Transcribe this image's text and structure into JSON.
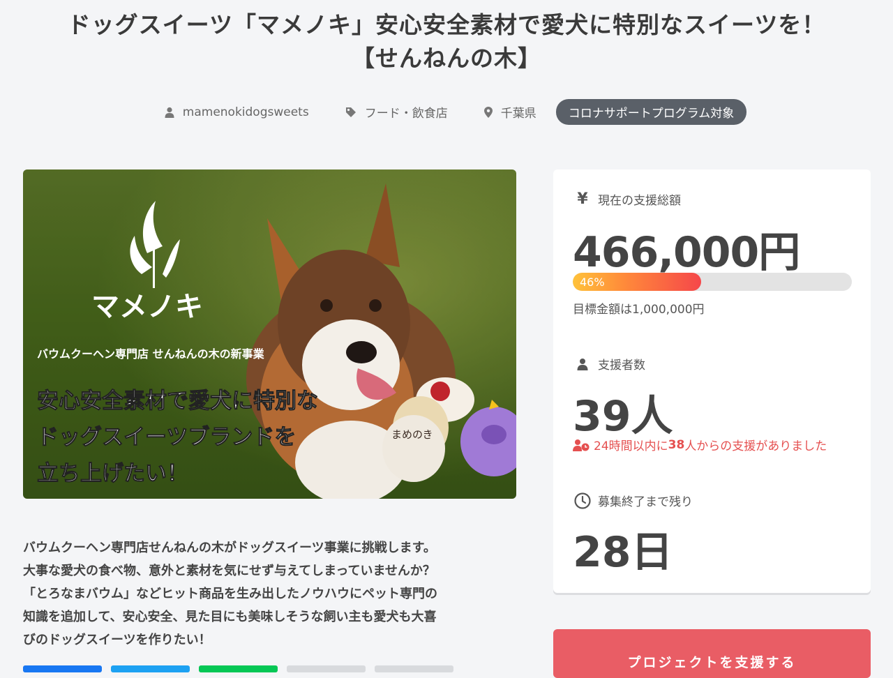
{
  "title": {
    "line1": "ドッグスイーツ「マメノキ」安心安全素材で愛犬に特別なスイーツを！",
    "line2": "【せんねんの木】"
  },
  "meta": {
    "owner": "mamenokidogsweets",
    "category": "フード・飲食店",
    "location": "千葉県",
    "badge": "コロナサポートプログラム対象"
  },
  "hero": {
    "brand": "マメノキ",
    "subtitle": "バウムクーヘン専門店 せんねんの木の新事業",
    "headline1": "安心安全素材で愛犬に特別な",
    "headline2": "ドッグスイーツブランドを",
    "headline3": "立ち上げたい！",
    "cake_label": "まめのき"
  },
  "description": [
    "バウムクーヘン専門店せんねんの木がドッグスイーツ事業に挑戦します。",
    "大事な愛犬の食べ物、意外と素材を気にせず与えてしまっていませんか？",
    "「とろなまバウム」などヒット商品を生み出したノウハウにペット専門の",
    "知識を追加して、安心安全、見た目にも美味しそうな飼い主も愛犬も大喜",
    "びのドッグスイーツを作りたい！"
  ],
  "stats": {
    "amount_label": "現在の支援総額",
    "amount": "466,000円",
    "progress_percent": 46,
    "progress_label": "46%",
    "goal": "目標金額は1,000,000円",
    "backers_label": "支援者数",
    "backers": "39人",
    "recent_pre": "24時間以内に",
    "recent_num": "38",
    "recent_post": "人からの支援がありました",
    "remaining_label": "募集終了まで残り",
    "remaining": "28日"
  },
  "support_button": "プロジェクトを支援する",
  "icons": {
    "owner": "user-icon",
    "category": "tag-icon",
    "location": "map-pin-icon",
    "amount": "yen-icon",
    "backers": "user-icon",
    "recent": "user-clock-icon",
    "remaining": "clock-icon"
  },
  "colors": {
    "accent": "#e95d65",
    "badge": "#5a6068",
    "recent": "#e55050",
    "share_facebook": "#1877f2",
    "share_twitter": "#1da1f2",
    "share_line": "#06c755"
  }
}
